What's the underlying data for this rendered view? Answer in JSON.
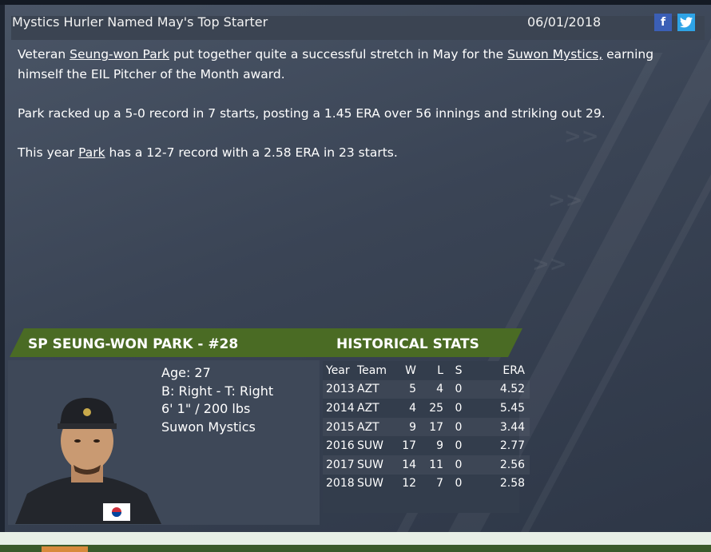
{
  "news": {
    "headline": "Mystics Hurler Named May's Top Starter",
    "date": "06/01/2018",
    "social": {
      "facebook": "f",
      "twitter_icon": "twitter-icon"
    },
    "p1": {
      "pre": "Veteran ",
      "player_link": "Seung-won Park",
      "mid": " put together quite a successful stretch in May for the ",
      "team_link": "Suwon Mystics,",
      "post": " earning himself the EIL Pitcher of the Month award."
    },
    "p2": "Park racked up a 5-0 record in 7 starts, posting a 1.45 ERA over 56 innings and striking out 29.",
    "p3": {
      "pre": "This year ",
      "player_link": "Park",
      "post": " has a 12-7 record with a 2.58 ERA in 23 starts."
    }
  },
  "card": {
    "title": "SP SEUNG-WON PARK - #28",
    "stats_title": "HISTORICAL STATS",
    "age": "Age: 27",
    "bats_throws": "B: Right - T: Right",
    "height_weight": "6' 1\" / 200 lbs",
    "team": "Suwon Mystics",
    "columns": [
      "Year",
      "Team",
      "W",
      "L",
      "S",
      "ERA"
    ],
    "rows": [
      {
        "year": "2013",
        "team": "AZT",
        "w": "5",
        "l": "4",
        "s": "0",
        "era": "4.52"
      },
      {
        "year": "2014",
        "team": "AZT",
        "w": "4",
        "l": "25",
        "s": "0",
        "era": "5.45"
      },
      {
        "year": "2015",
        "team": "AZT",
        "w": "9",
        "l": "17",
        "s": "0",
        "era": "3.44"
      },
      {
        "year": "2016",
        "team": "SUW",
        "w": "17",
        "l": "9",
        "s": "0",
        "era": "2.77"
      },
      {
        "year": "2017",
        "team": "SUW",
        "w": "14",
        "l": "11",
        "s": "0",
        "era": "2.56"
      },
      {
        "year": "2018",
        "team": "SUW",
        "w": "12",
        "l": "7",
        "s": "0",
        "era": "2.58"
      }
    ]
  },
  "colors": {
    "banner": "#4a6b24",
    "facebook": "#3b5fb6",
    "twitter": "#2ea3e6"
  }
}
